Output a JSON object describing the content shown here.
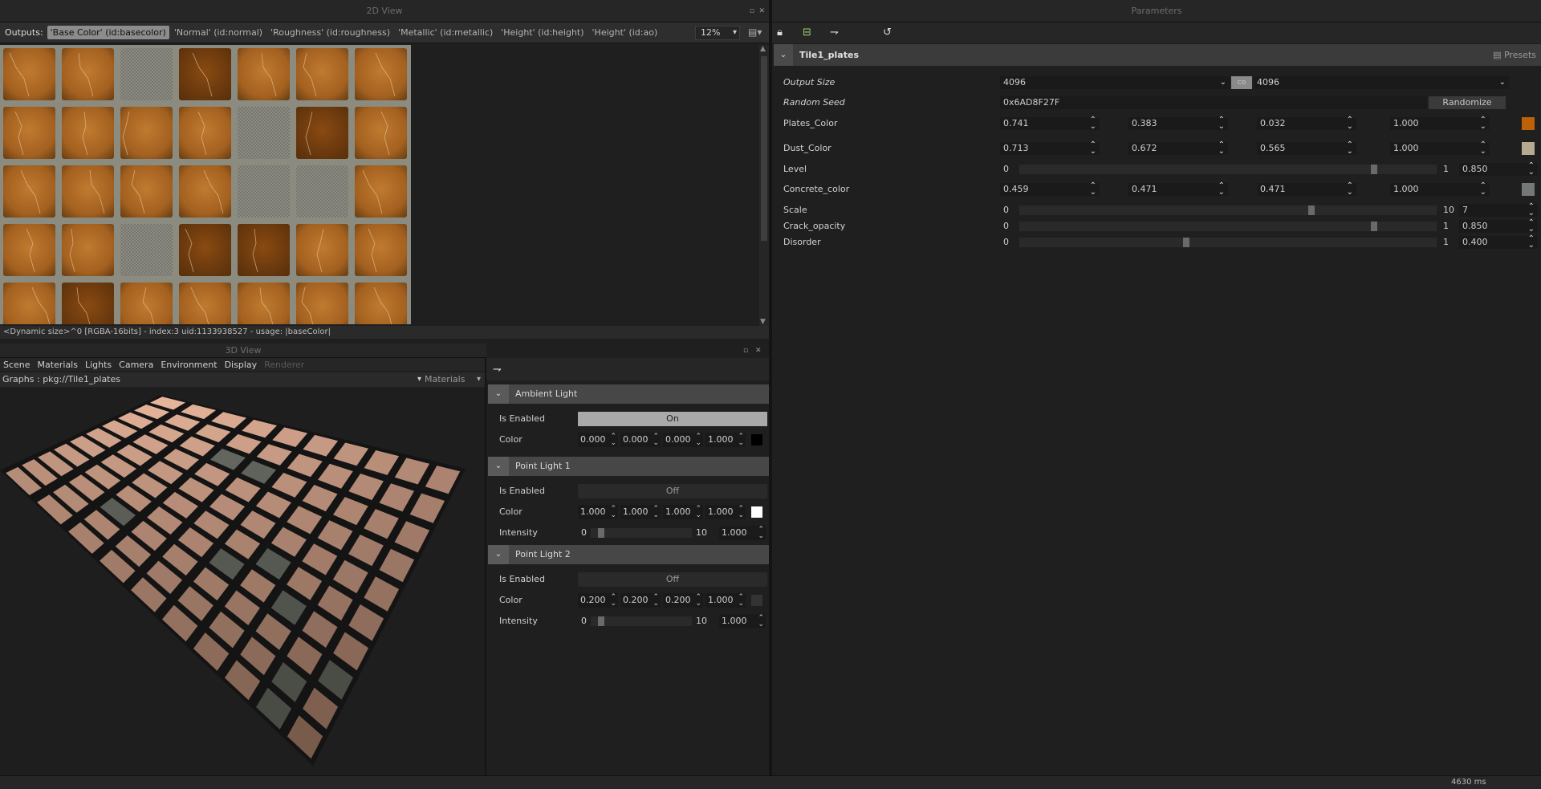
{
  "view2d": {
    "title": "2D View",
    "outputs_label": "Outputs:",
    "outputs": [
      "'Base Color' (id:basecolor)",
      "'Normal' (id:normal)",
      "'Roughness' (id:roughness)",
      "'Metallic' (id:metallic)",
      "'Height' (id:height)",
      "'Height' (id:ao)"
    ],
    "zoom": "12%",
    "status": "<Dynamic size>^0 [RGBA-16bits] - index:3 uid:1133938527 - usage: |baseColor|"
  },
  "view3d": {
    "title": "3D View",
    "menu": [
      "Scene",
      "Materials",
      "Lights",
      "Camera",
      "Environment",
      "Display",
      "Renderer"
    ],
    "graphs_label": "Graphs :",
    "graphs_value": "pkg://Tile1_plates",
    "materials_label": "Materials"
  },
  "lights": {
    "ambient": {
      "title": "Ambient Light",
      "enabled_label": "Is Enabled",
      "enabled_value": "On",
      "color_label": "Color",
      "color": [
        "0.000",
        "0.000",
        "0.000",
        "1.000"
      ],
      "swatch": "#000000"
    },
    "point1": {
      "title": "Point Light 1",
      "enabled_label": "Is Enabled",
      "enabled_value": "Off",
      "color_label": "Color",
      "color": [
        "1.000",
        "1.000",
        "1.000",
        "1.000"
      ],
      "swatch": "#ffffff",
      "intensity_label": "Intensity",
      "min": "0",
      "max": "10",
      "value": "1.000",
      "fraction": 0.1
    },
    "point2": {
      "title": "Point Light 2",
      "enabled_label": "Is Enabled",
      "enabled_value": "Off",
      "color_label": "Color",
      "color": [
        "0.200",
        "0.200",
        "0.200",
        "1.000"
      ],
      "swatch": "#333333",
      "intensity_label": "Intensity",
      "min": "0",
      "max": "10",
      "value": "1.000",
      "fraction": 0.1
    }
  },
  "params": {
    "title": "Parameters",
    "section": "Tile1_plates",
    "presets": "Presets",
    "output_size_label": "Output Size",
    "output_size_w": "4096",
    "output_size_h": "4096",
    "link_label": "co",
    "random_seed_label": "Random Seed",
    "random_seed": "0x6AD8F27F",
    "randomize": "Randomize",
    "plates_color": {
      "label": "Plates_Color",
      "values": [
        "0.741",
        "0.383",
        "0.032",
        "1.000"
      ],
      "swatch": "#bd6108"
    },
    "dust_color": {
      "label": "Dust_Color",
      "values": [
        "0.713",
        "0.672",
        "0.565",
        "1.000"
      ],
      "swatch": "#b6ab90"
    },
    "level": {
      "label": "Level",
      "min": "0",
      "max": "1",
      "value": "0.850",
      "fraction": 0.85
    },
    "concrete_color": {
      "label": "Concrete_color",
      "values": [
        "0.459",
        "0.471",
        "0.471",
        "1.000"
      ],
      "swatch": "#757878"
    },
    "scale": {
      "label": "Scale",
      "min": "0",
      "max": "10",
      "value": "7",
      "fraction": 0.7
    },
    "crack_opacity": {
      "label": "Crack_opacity",
      "min": "0",
      "max": "1",
      "value": "0.850",
      "fraction": 0.85
    },
    "disorder": {
      "label": "Disorder",
      "min": "0",
      "max": "1",
      "value": "0.400",
      "fraction": 0.4
    }
  },
  "status": {
    "time": "4630 ms"
  }
}
